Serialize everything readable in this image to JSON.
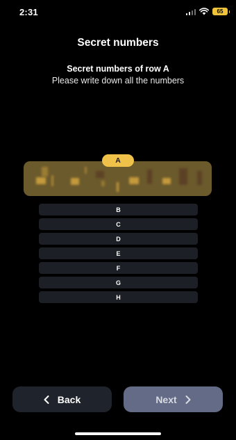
{
  "status_bar": {
    "time": "2:31",
    "battery_level": "65",
    "battery_color": "#f0c43a"
  },
  "header": {
    "title": "Secret numbers"
  },
  "content": {
    "subtitle": "Secret numbers of row A",
    "instruction": "Please write down all the numbers"
  },
  "row_a": {
    "label": "A",
    "accent": "#f0c24a"
  },
  "rows": [
    {
      "label": "B"
    },
    {
      "label": "C"
    },
    {
      "label": "D"
    },
    {
      "label": "E"
    },
    {
      "label": "F"
    },
    {
      "label": "G"
    },
    {
      "label": "H"
    }
  ],
  "footer": {
    "back_label": "Back",
    "next_label": "Next",
    "back_icon": "chevron-left-icon",
    "next_icon": "chevron-right-icon"
  }
}
